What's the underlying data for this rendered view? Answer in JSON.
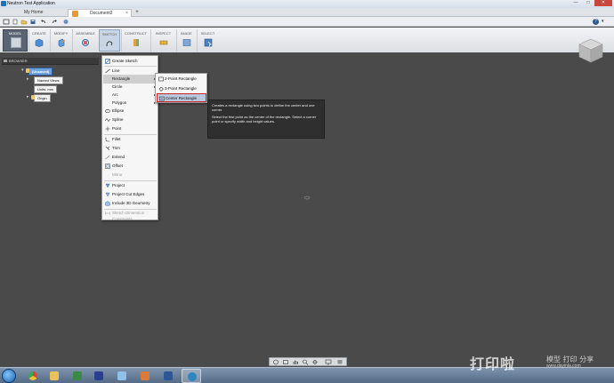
{
  "window": {
    "title": "Neutron Test Application",
    "min_glyph": "—",
    "max_glyph": "□",
    "close_glyph": "✕"
  },
  "tabs": {
    "home": "My Home",
    "document": "Document2",
    "close_glyph": "×",
    "new_glyph": "+"
  },
  "qat": {
    "help_glyph": "?",
    "user_glyph": "▾"
  },
  "ribbon": {
    "workspace": "MODEL",
    "groups": [
      "CREATE",
      "MODIFY",
      "ASSEMBLE",
      "SKETCH",
      "CONSTRUCT",
      "INSPECT",
      "IMAGE",
      "SELECT"
    ]
  },
  "browser": {
    "header": "BROWSER",
    "root": "(Unsaved)",
    "named_views": "Named Views",
    "units": "Units: mm",
    "origin": "Origin"
  },
  "create_menu": {
    "items": [
      "Create Sketch",
      "Line",
      "Rectangle",
      "Circle",
      "Arc",
      "Polygon",
      "Ellipse",
      "Spline",
      "Point",
      "Fillet",
      "Trim",
      "Extend",
      "Offset",
      "Mirror",
      "Project",
      "Project Cut Edges",
      "Include 3D Geometry",
      "Sketch Dimension",
      "Constraints"
    ],
    "arrow_glyph": "▸"
  },
  "rectangle_menu": {
    "items": [
      "2-Point Rectangle",
      "3-Point Rectangle",
      "Center Rectangle"
    ]
  },
  "tooltip": {
    "line1": "Creates a rectangle using two points to define the center and one corner.",
    "line2": "Select the first point as the center of the rectangle. Select a corner point or specify width and height values."
  },
  "watermark": {
    "big": "打印啦",
    "small": "模型 打印 分享",
    "url": "www.dayinla.com"
  },
  "colors": {
    "canvas": "#4a4a4a",
    "selection_outline": "#c8232a",
    "selected_node": "#6fa1dc"
  }
}
